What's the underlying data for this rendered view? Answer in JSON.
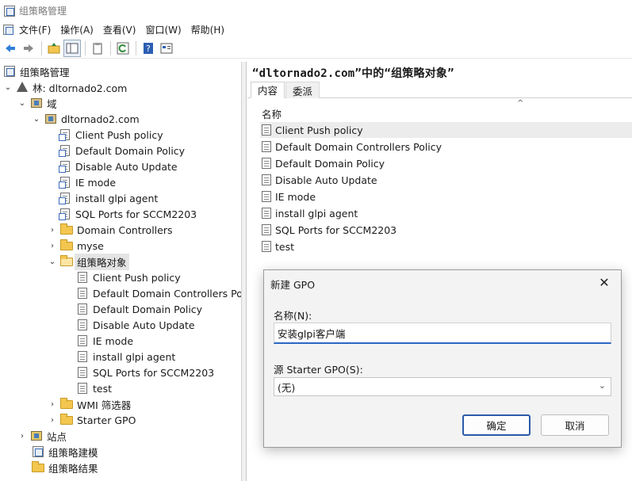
{
  "window": {
    "title": "组策略管理"
  },
  "menu": [
    "文件(F)",
    "操作(A)",
    "查看(V)",
    "窗口(W)",
    "帮助(H)"
  ],
  "tree": {
    "root": "组策略管理",
    "forest": "林: dltornado2.com",
    "domains": "域",
    "domain": "dltornado2.com",
    "domain_links": [
      "Client Push policy",
      "Default Domain Policy",
      "Disable Auto Update",
      "IE mode",
      "install glpi agent",
      "SQL Ports for SCCM2203"
    ],
    "ous": [
      "Domain Controllers",
      "myse"
    ],
    "gpo_container": "组策略对象",
    "gpos": [
      "Client Push policy",
      "Default Domain Controllers Policy",
      "Default Domain Policy",
      "Disable Auto Update",
      "IE mode",
      "install glpi agent",
      "SQL Ports for SCCM2203",
      "test"
    ],
    "wmi": "WMI 筛选器",
    "starter": "Starter GPO",
    "sites": "站点",
    "modeling": "组策略建模",
    "results": "组策略结果"
  },
  "right": {
    "title": "“dltornado2.com”中的“组策略对象”",
    "tabs": [
      "内容",
      "委派"
    ],
    "column": "名称",
    "items": [
      "Client Push policy",
      "Default Domain Controllers Policy",
      "Default Domain Policy",
      "Disable Auto Update",
      "IE mode",
      "install glpi agent",
      "SQL Ports for SCCM2203",
      "test"
    ]
  },
  "dialog": {
    "title": "新建 GPO",
    "name_label": "名称(N):",
    "name_value": "安装glpi客户端",
    "starter_label": "源 Starter GPO(S):",
    "starter_value": "(无)",
    "ok": "确定",
    "cancel": "取消"
  }
}
